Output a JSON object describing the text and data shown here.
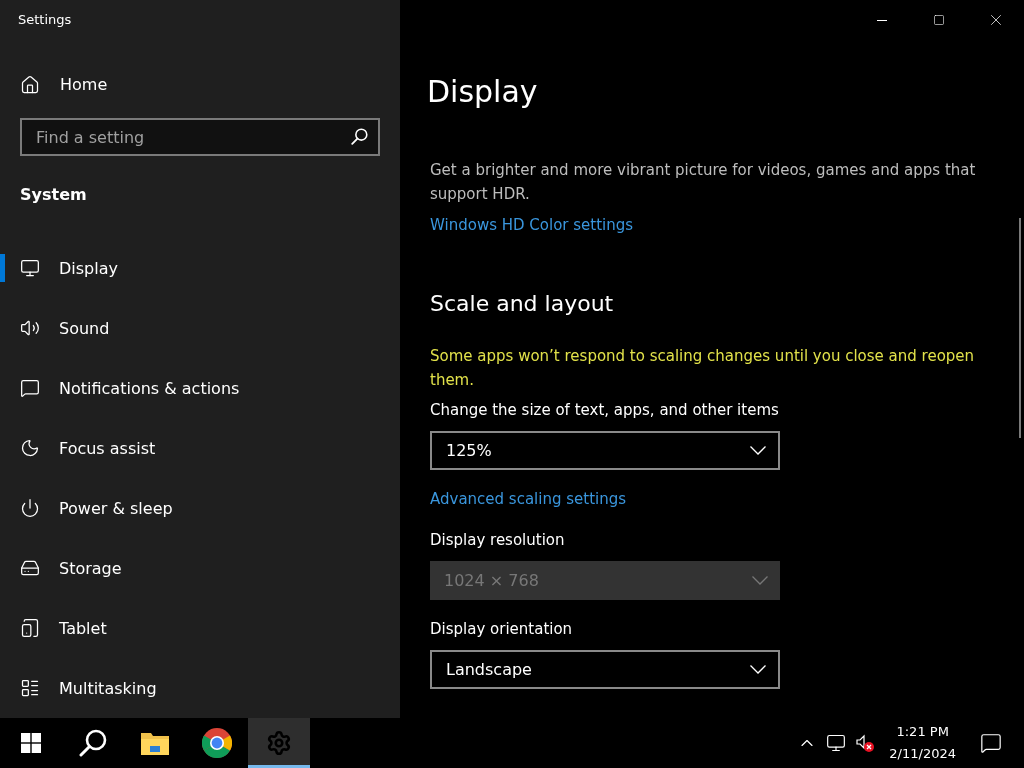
{
  "window": {
    "title": "Settings"
  },
  "sidebar": {
    "home": "Home",
    "search": {
      "placeholder": "Find a setting"
    },
    "section": "System",
    "items": [
      {
        "label": "Display",
        "selected": true
      },
      {
        "label": "Sound",
        "selected": false
      },
      {
        "label": "Notifications & actions",
        "selected": false
      },
      {
        "label": "Focus assist",
        "selected": false
      },
      {
        "label": "Power & sleep",
        "selected": false
      },
      {
        "label": "Storage",
        "selected": false
      },
      {
        "label": "Tablet",
        "selected": false
      },
      {
        "label": "Multitasking",
        "selected": false
      }
    ]
  },
  "page": {
    "title": "Display",
    "items": [
      {
        "kind": "text",
        "text": "Get a brighter and more vibrant picture for videos, games and apps that support HDR."
      },
      {
        "kind": "link",
        "text": "Windows HD Color settings"
      },
      {
        "kind": "heading",
        "text": "Scale and layout"
      },
      {
        "kind": "warning",
        "text": "Some apps won’t respond to scaling changes until you close and reopen them."
      },
      {
        "kind": "label",
        "text": "Change the size of text, apps, and other items"
      },
      {
        "kind": "select",
        "value": "125%",
        "disabled": false
      },
      {
        "kind": "link",
        "text": "Advanced scaling settings"
      },
      {
        "kind": "label",
        "text": "Display resolution"
      },
      {
        "kind": "select",
        "value": "1024 × 768",
        "disabled": true
      },
      {
        "kind": "label",
        "text": "Display orientation"
      },
      {
        "kind": "select",
        "value": "Landscape",
        "disabled": false
      }
    ]
  },
  "taskbar": {
    "apps": [
      {
        "selected": false
      },
      {
        "selected": false
      },
      {
        "selected": false
      },
      {
        "selected": false
      },
      {
        "selected": true
      }
    ],
    "time": "1:21 PM",
    "date": "2/11/2024"
  }
}
